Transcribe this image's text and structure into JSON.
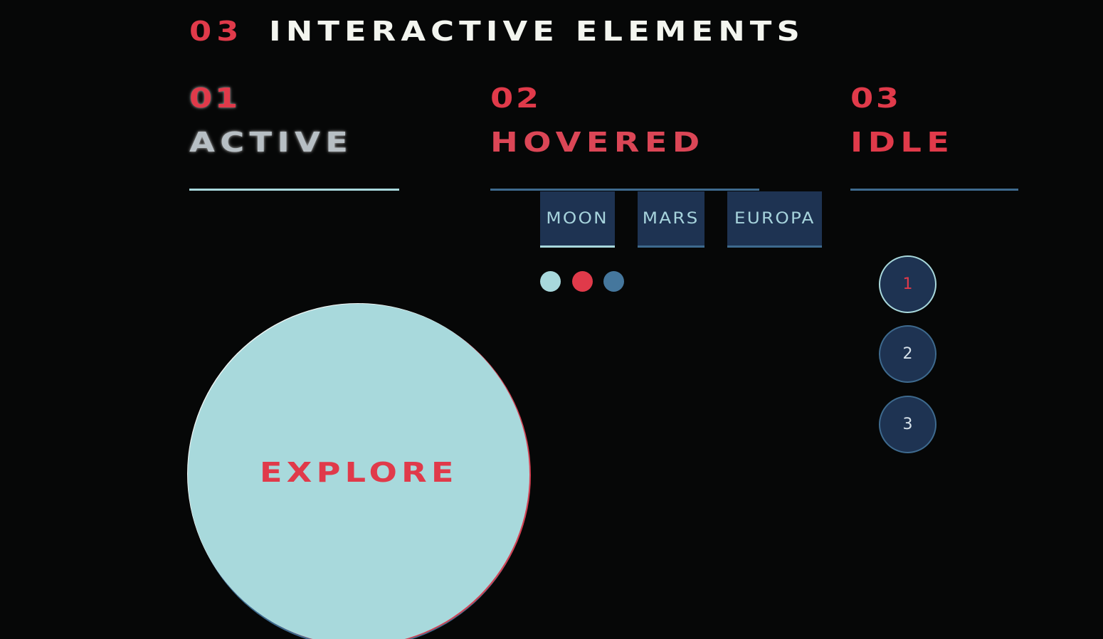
{
  "section": {
    "number": "03",
    "title": "INTERACTIVE ELEMENTS"
  },
  "states": [
    {
      "number": "01",
      "label": "ACTIVE"
    },
    {
      "number": "02",
      "label": "HOVERED"
    },
    {
      "number": "03",
      "label": "IDLE"
    }
  ],
  "tabs": [
    {
      "label": "MOON"
    },
    {
      "label": "MARS"
    },
    {
      "label": "EUROPA"
    }
  ],
  "number_buttons": [
    "1",
    "2",
    "3"
  ],
  "explore_button": {
    "label": "EXPLORE"
  },
  "colors": {
    "background": "#060707",
    "accent_red": "#e03a4a",
    "light_cyan": "#a8d8dc",
    "navy": "#1e3352",
    "steel_blue": "#3e6a8e",
    "white": "#f3f5ef"
  }
}
